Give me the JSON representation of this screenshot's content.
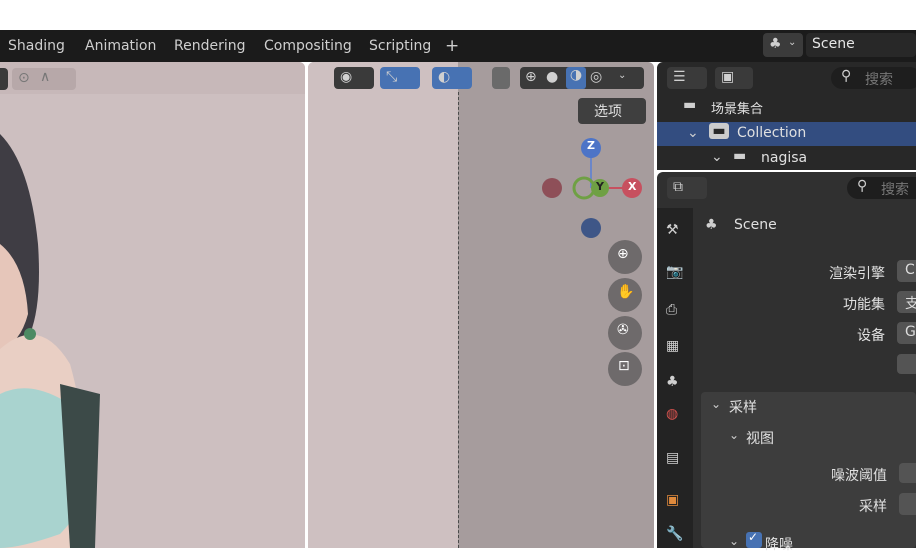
{
  "tabs": [
    "Shading",
    "Animation",
    "Rendering",
    "Compositing",
    "Scripting",
    "+"
  ],
  "scene_selector": {
    "label": "Scene"
  },
  "viewport_right": {
    "options_label": "选项",
    "axes": {
      "z": "Z",
      "y": "Y",
      "x": "X"
    }
  },
  "outliner": {
    "search_placeholder": "搜索",
    "scene_collection": "场景集合",
    "collection": "Collection",
    "object": "nagisa"
  },
  "properties": {
    "search_placeholder": "搜索",
    "context_title": "Scene",
    "render_engine_label": "渲染引擎",
    "render_engine_value": "C",
    "feature_set_label": "功能集",
    "feature_set_value": "支",
    "device_label": "设备",
    "device_value": "G",
    "sampling_panel": "采样",
    "viewport_subpanel": "视图",
    "noise_threshold_label": "噪波阈值",
    "samples_label": "采样",
    "denoise_label": "降噪"
  }
}
